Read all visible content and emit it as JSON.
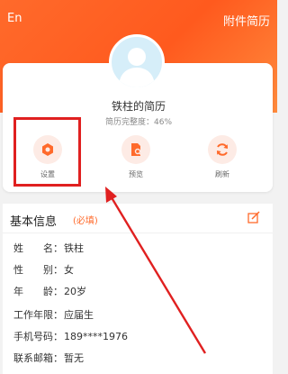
{
  "header": {
    "lang_toggle": "En",
    "attachment_resume": "附件简历"
  },
  "profile": {
    "title": "铁柱的简历",
    "completeness_label": "简历完整度：",
    "completeness_value": "46%"
  },
  "actions": [
    {
      "label": "设置",
      "icon": "gear-icon"
    },
    {
      "label": "预览",
      "icon": "preview-icon"
    },
    {
      "label": "刷新",
      "icon": "refresh-icon"
    }
  ],
  "basic_info": {
    "title": "基本信息",
    "required": "(必填)",
    "rows": [
      {
        "key": "姓　　名：",
        "value": "铁柱"
      },
      {
        "key": "性　　别：",
        "value": "女"
      },
      {
        "key": "年　　龄：",
        "value": "20岁"
      },
      {
        "key": "工作年限：",
        "value": "应届生"
      },
      {
        "key": "手机号码：",
        "value": "189****1976"
      },
      {
        "key": "联系邮箱：",
        "value": "暂无"
      }
    ]
  },
  "colors": {
    "accent": "#ff6a2b",
    "annotation": "#e02020"
  }
}
